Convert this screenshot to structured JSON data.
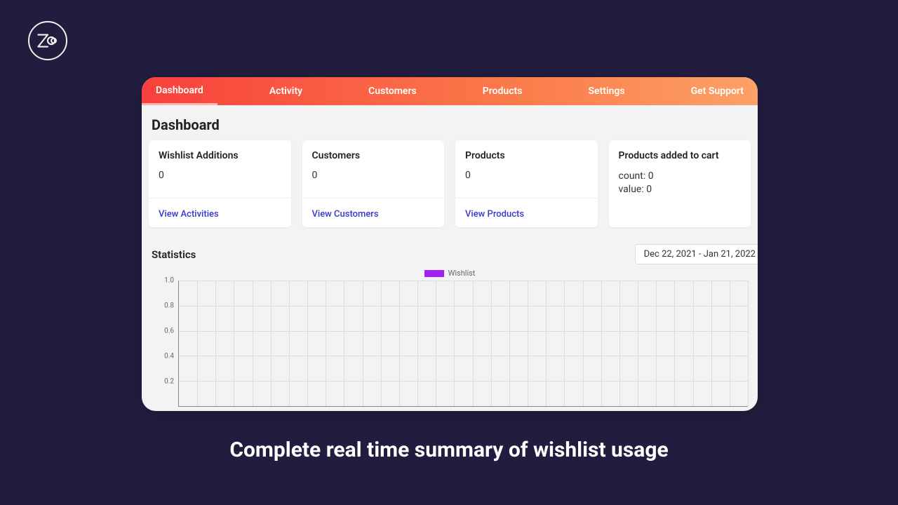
{
  "tabs": [
    "Dashboard",
    "Activity",
    "Customers",
    "Products",
    "Settings",
    "Get Support"
  ],
  "active_tab": 0,
  "page_title": "Dashboard",
  "cards": [
    {
      "title": "Wishlist Additions",
      "value": "0",
      "link": "View Activities"
    },
    {
      "title": "Customers",
      "value": "0",
      "link": "View Customers"
    },
    {
      "title": "Products",
      "value": "0",
      "link": "View Products"
    },
    {
      "title": "Products added to cart",
      "lines": [
        "count: 0",
        "value: 0"
      ]
    }
  ],
  "stats_title": "Statistics",
  "date_range": "Dec 22, 2021 - Jan 21, 2022",
  "legend": "Wishlist",
  "caption": "Complete real time summary of wishlist usage",
  "chart_data": {
    "type": "line",
    "title": "",
    "xlabel": "",
    "ylabel": "",
    "ylim": [
      0,
      1
    ],
    "y_ticks": [
      1.0,
      0.8,
      0.6,
      0.4,
      0.2
    ],
    "x_count": 31,
    "series": [
      {
        "name": "Wishlist",
        "values": []
      }
    ]
  }
}
